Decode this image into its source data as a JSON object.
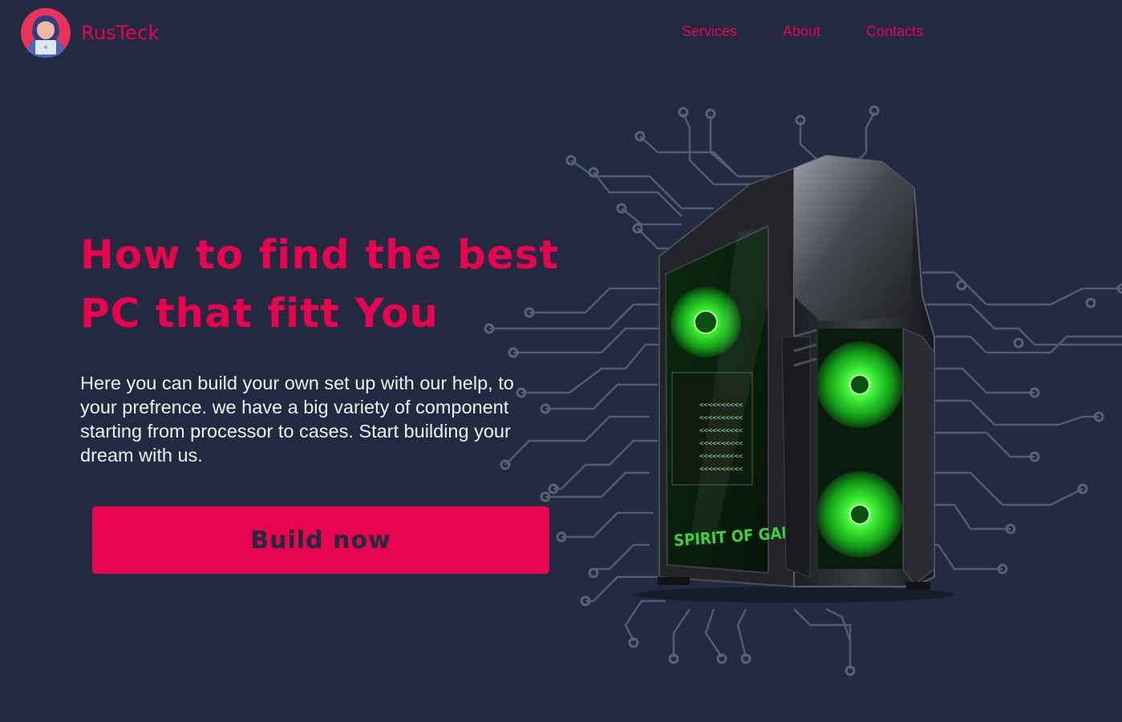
{
  "brand": {
    "name": "RusTeck",
    "logo_icon": "hooded-hacker-laptop-avatar"
  },
  "nav": {
    "items": [
      {
        "label": "Services"
      },
      {
        "label": "About"
      },
      {
        "label": "Contacts"
      }
    ]
  },
  "hero": {
    "title_line1": "How to find the best",
    "title_line2": "PC that fitt You",
    "description": "Here you can build your own set up with our help, to your prefrence. we have a big variety of component starting from processor to cases. Start building your dream with us.",
    "button_label": "Build now"
  },
  "illustration": {
    "case_label": "SPIRIT OF GAMER",
    "image": "gaming-pc-case-green-fans-circuit-background"
  },
  "colors": {
    "background": "#222a41",
    "accent": "#e8034f",
    "text": "#eef0f5",
    "fan_glow": "#2ee82a",
    "circuit": "#56617c"
  }
}
